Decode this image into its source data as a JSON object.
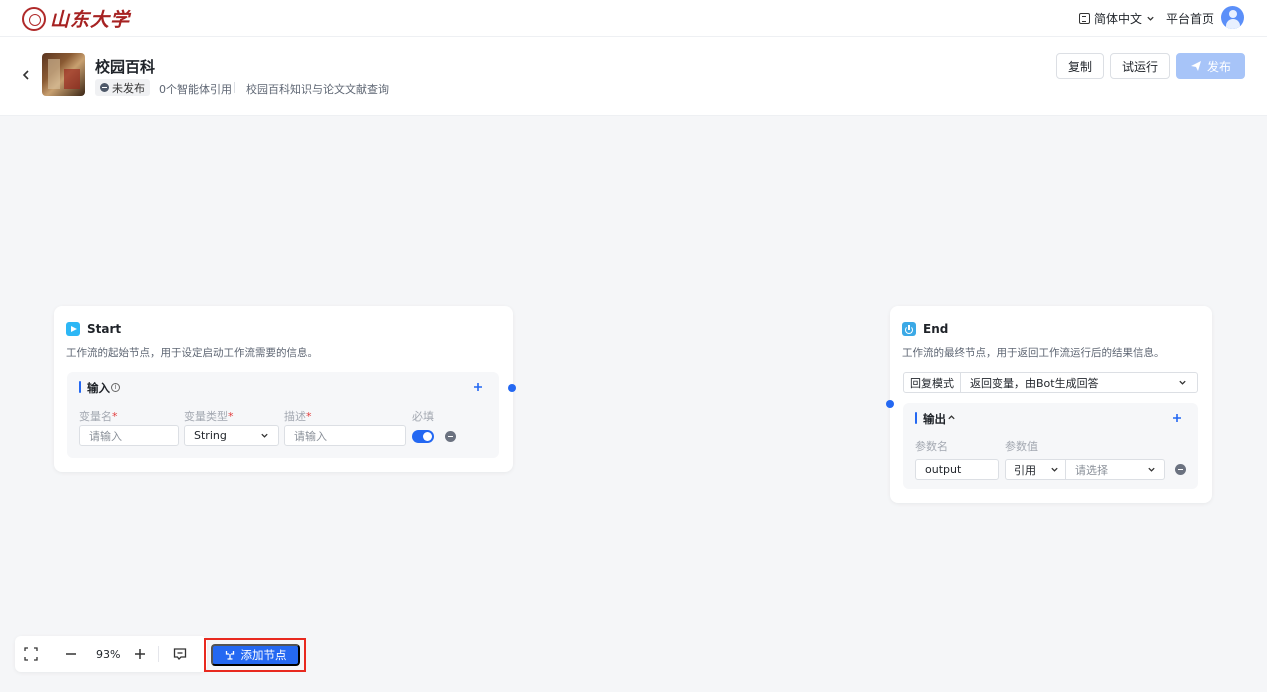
{
  "topnav": {
    "logo_text": "山东大学",
    "language": "简体中文",
    "home_label": "平台首页"
  },
  "header": {
    "title": "校园百科",
    "status": "未发布",
    "agent_refs": "0个智能体引用",
    "description": "校园百科知识与论文文献查询",
    "buttons": {
      "copy": "复制",
      "test_run": "试运行",
      "publish": "发布"
    }
  },
  "start_node": {
    "title": "Start",
    "description": "工作流的起始节点，用于设定启动工作流需要的信息。",
    "section_label": "输入",
    "columns": {
      "name": "变量名",
      "type": "变量类型",
      "desc": "描述",
      "required": "必填"
    },
    "row": {
      "name_placeholder": "请输入",
      "type_value": "String",
      "desc_placeholder": "请输入",
      "required": true
    }
  },
  "end_node": {
    "title": "End",
    "description": "工作流的最终节点，用于返回工作流运行后的结果信息。",
    "reply_mode_label": "回复模式",
    "reply_mode_value": "返回变量，由Bot生成回答",
    "section_label": "输出",
    "columns": {
      "param_name": "参数名",
      "param_value": "参数值"
    },
    "row": {
      "name": "output",
      "ref_type": "引用",
      "select_placeholder": "请选择"
    }
  },
  "toolbar": {
    "zoom": "93%",
    "add_node_label": "添加节点"
  },
  "colors": {
    "accent": "#2468f2",
    "publish_disabled": "#a7c4f8",
    "highlight": "#e8291f"
  }
}
